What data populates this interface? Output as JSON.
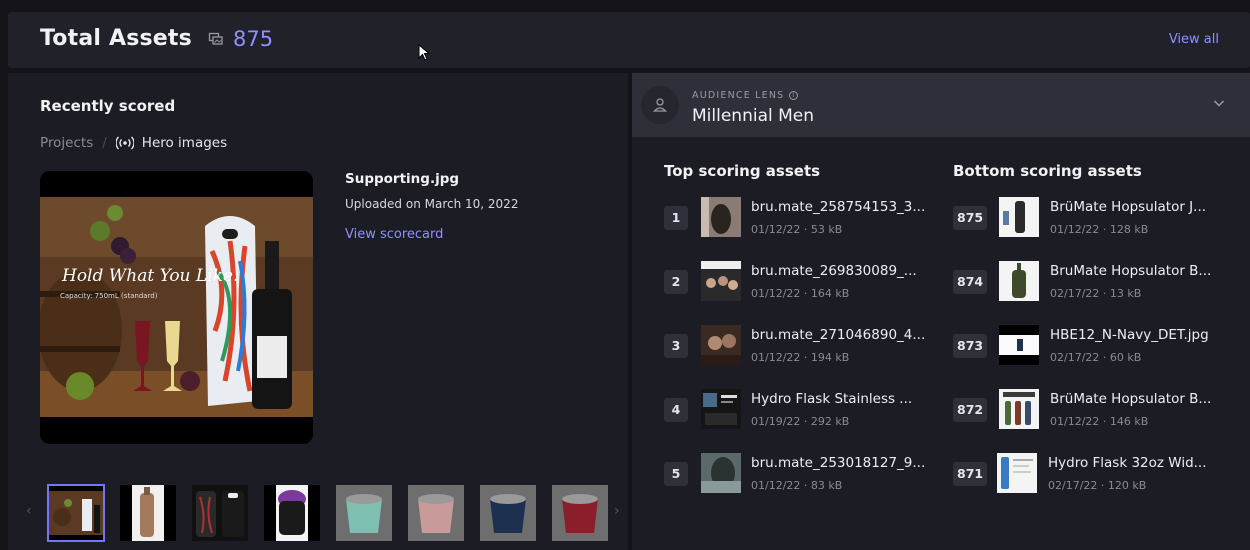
{
  "header": {
    "title": "Total Assets",
    "count": "875",
    "view_all": "View all"
  },
  "recent": {
    "heading": "Recently scored",
    "breadcrumb_root": "Projects",
    "breadcrumb_separator": "/",
    "breadcrumb_current": "Hero images",
    "file_name": "Supporting.jpg",
    "uploaded": "Uploaded on March 10, 2022",
    "view_scorecard": "View scorecard",
    "preview_text": "Hold What You Like.",
    "preview_subtext": "Capacity: 750mL (standard)",
    "arrow_prev": "‹",
    "arrow_next": "›"
  },
  "lens": {
    "label": "AUDIENCE LENS",
    "info_glyph": "i",
    "name": "Millennial Men"
  },
  "top": {
    "heading": "Top scoring assets",
    "items": [
      {
        "rank": "1",
        "name": "bru.mate_258754153_3...",
        "date": "01/12/22",
        "size": "53 kB"
      },
      {
        "rank": "2",
        "name": "bru.mate_269830089_...",
        "date": "01/12/22",
        "size": "164 kB"
      },
      {
        "rank": "3",
        "name": "bru.mate_271046890_4...",
        "date": "01/12/22",
        "size": "194 kB"
      },
      {
        "rank": "4",
        "name": "Hydro Flask Stainless ...",
        "date": "01/19/22",
        "size": "292 kB"
      },
      {
        "rank": "5",
        "name": "bru.mate_253018127_9...",
        "date": "01/12/22",
        "size": "83 kB"
      }
    ]
  },
  "bottom": {
    "heading": "Bottom scoring assets",
    "items": [
      {
        "rank": "875",
        "name": "BrüMate Hopsulator J...",
        "date": "01/12/22",
        "size": "128 kB"
      },
      {
        "rank": "874",
        "name": "BruMate Hopsulator B...",
        "date": "02/17/22",
        "size": "13 kB"
      },
      {
        "rank": "873",
        "name": "HBE12_N-Navy_DET.jpg",
        "date": "02/17/22",
        "size": "60 kB"
      },
      {
        "rank": "872",
        "name": "BrüMate Hopsulator B...",
        "date": "01/12/22",
        "size": "146 kB"
      },
      {
        "rank": "871",
        "name": "Hydro Flask 32oz Wid...",
        "date": "02/17/22",
        "size": "120 kB"
      }
    ]
  },
  "colors": {
    "accent": "#8f90ff",
    "panel": "#1c1c24",
    "header": "#21212a",
    "lens_bar": "#2f2f3a"
  }
}
